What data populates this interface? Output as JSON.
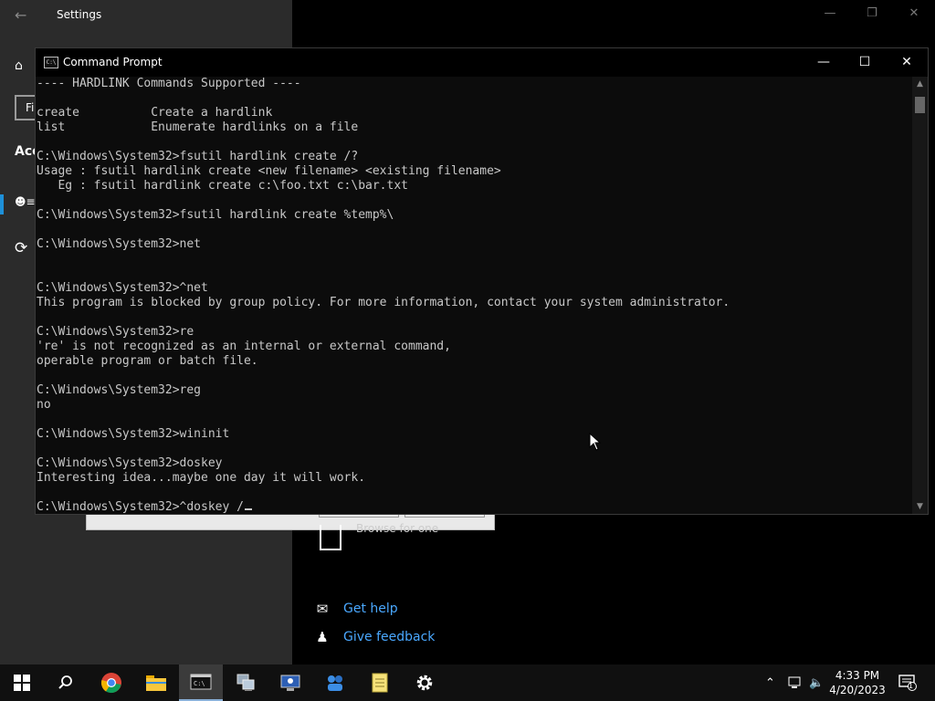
{
  "settings": {
    "title": "Settings",
    "search_partial": "Fi",
    "section_partial": "Acc",
    "browse_text": "Browse for one",
    "get_help": "Get help",
    "give_feedback": "Give feedback"
  },
  "cmd": {
    "title": "Command Prompt",
    "lines": [
      "---- HARDLINK Commands Supported ----",
      "",
      "create          Create a hardlink",
      "list            Enumerate hardlinks on a file",
      "",
      "C:\\Windows\\System32>fsutil hardlink create /?",
      "Usage : fsutil hardlink create <new filename> <existing filename>",
      "   Eg : fsutil hardlink create c:\\foo.txt c:\\bar.txt",
      "",
      "C:\\Windows\\System32>fsutil hardlink create %temp%\\",
      "",
      "C:\\Windows\\System32>net",
      "",
      "",
      "C:\\Windows\\System32>^net",
      "This program is blocked by group policy. For more information, contact your system administrator.",
      "",
      "C:\\Windows\\System32>re",
      "'re' is not recognized as an internal or external command,",
      "operable program or batch file.",
      "",
      "C:\\Windows\\System32>reg",
      "no",
      "",
      "C:\\Windows\\System32>wininit",
      "",
      "C:\\Windows\\System32>doskey",
      "Interesting idea...maybe one day it will work.",
      "",
      "C:\\Windows\\System32>^doskey /"
    ]
  },
  "taskbar": {
    "time": "4:33 PM",
    "date": "4/20/2023",
    "notification_count": "1"
  },
  "colors": {
    "accent": "#1e90d8",
    "link": "#4aa8ff",
    "console_text": "#c8c8c8"
  }
}
